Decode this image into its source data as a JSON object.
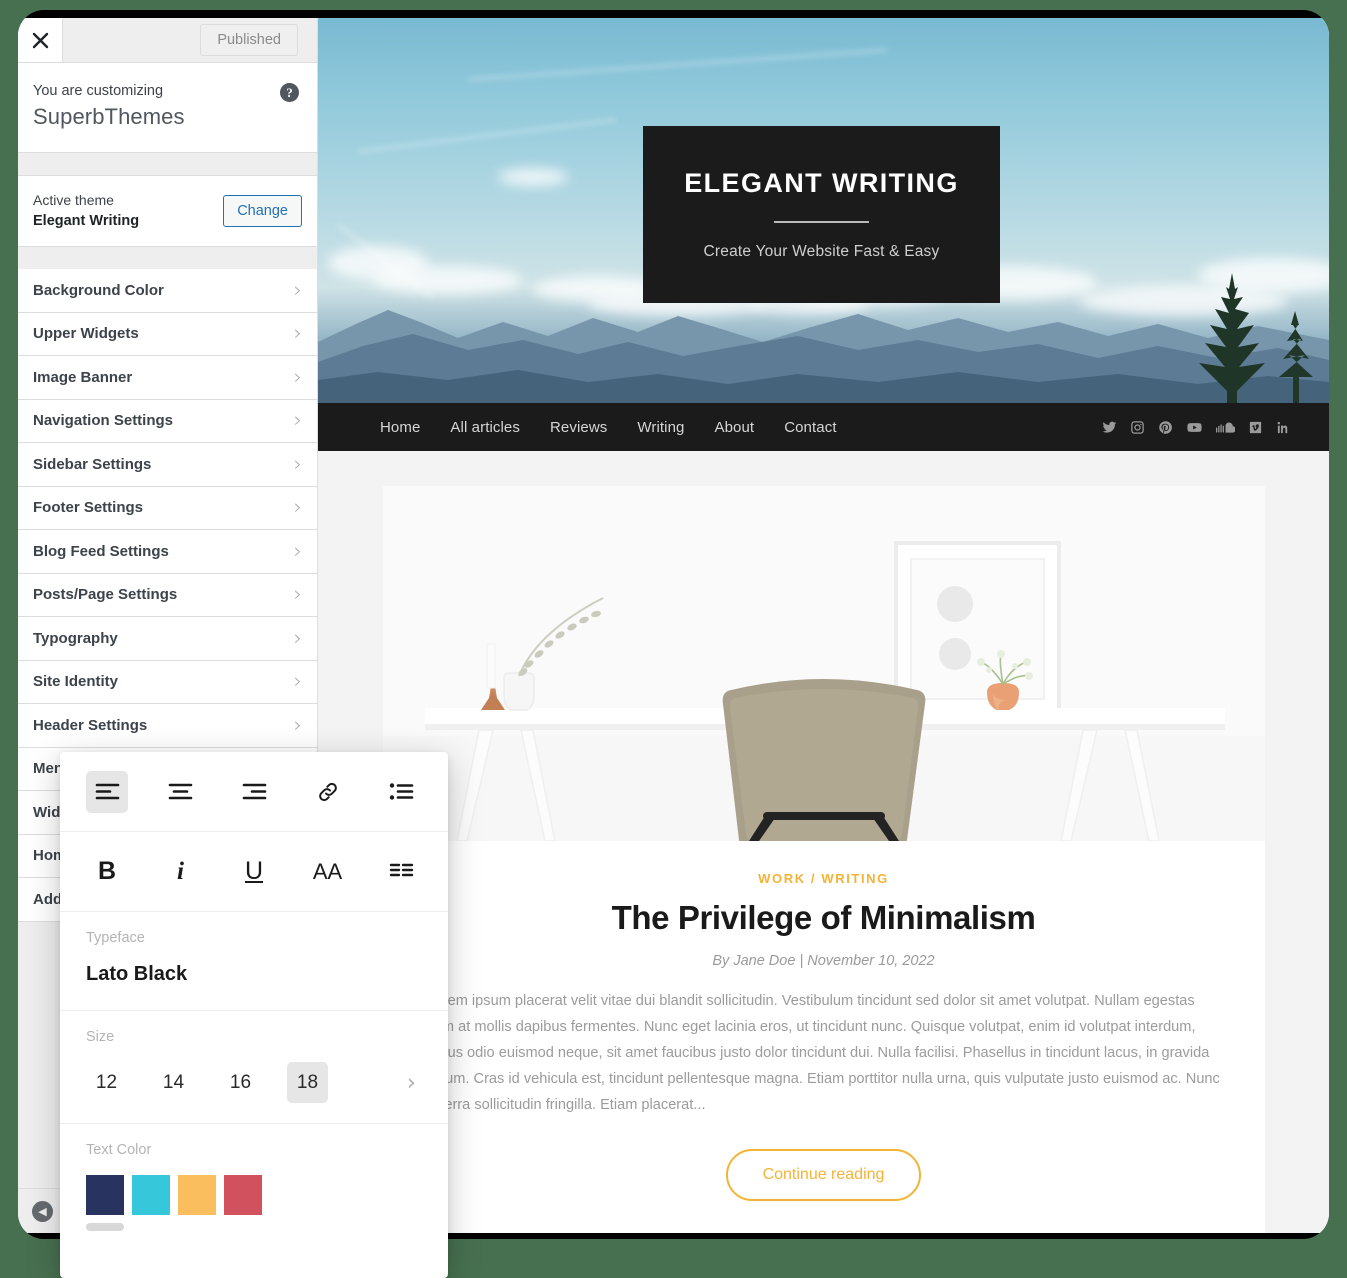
{
  "page": {
    "background_color": "#477050"
  },
  "customizer": {
    "close_icon": "close-icon",
    "published_label": "Published",
    "customizing_label": "You are customizing",
    "site_name": "SuperbThemes",
    "help_icon": "?",
    "active_theme_label": "Active theme",
    "active_theme_name": "Elegant Writing",
    "change_button": "Change",
    "sections": [
      {
        "label": "Background Color"
      },
      {
        "label": "Upper Widgets"
      },
      {
        "label": "Image Banner"
      },
      {
        "label": "Navigation Settings"
      },
      {
        "label": "Sidebar Settings"
      },
      {
        "label": "Footer Settings"
      },
      {
        "label": "Blog Feed Settings"
      },
      {
        "label": "Posts/Page Settings"
      },
      {
        "label": "Typography"
      },
      {
        "label": "Site Identity"
      },
      {
        "label": "Header Settings"
      },
      {
        "label": "Menus"
      },
      {
        "label": "Widgets"
      },
      {
        "label": "Homepage Settings"
      },
      {
        "label": "Additional CSS"
      }
    ],
    "chevron": "›",
    "collapse_label": "Hide Controls"
  },
  "preview": {
    "hero": {
      "title": "ELEGANT WRITING",
      "subtitle": "Create Your Website Fast & Easy"
    },
    "nav": {
      "items": [
        {
          "label": "Home"
        },
        {
          "label": "All articles"
        },
        {
          "label": "Reviews"
        },
        {
          "label": "Writing"
        },
        {
          "label": "About"
        },
        {
          "label": "Contact"
        }
      ],
      "social": [
        {
          "name": "twitter-icon"
        },
        {
          "name": "instagram-icon"
        },
        {
          "name": "pinterest-icon"
        },
        {
          "name": "youtube-icon"
        },
        {
          "name": "soundcloud-icon"
        },
        {
          "name": "vimeo-icon"
        },
        {
          "name": "linkedin-icon"
        }
      ]
    },
    "post": {
      "category": "WORK / WRITING",
      "title": "The Privilege of Minimalism",
      "meta": "By Jane Doe | November 10, 2022",
      "excerpt": "Lorem ipsum placerat velit vitae dui blandit sollicitudin. Vestibulum tincidunt sed dolor sit amet volutpat. Nullam egestas sem at mollis dapibus fermentes. Nunc eget lacinia eros, ut tincidunt nunc. Quisque volutpat, enim id volutpat interdum, purus odio euismod neque, sit amet faucibus justo dolor tincidunt dui. Nulla facilisi. Phasellus in tincidunt lacus, in gravida ipsum. Cras id vehicula est, tincidunt pellentesque magna. Etiam porttitor nulla urna, quis vulputate justo euismod ac. Nunc viverra sollicitudin fringilla. Etiam placerat...",
      "continue_label": "Continue reading",
      "accent_color": "#f5b335"
    }
  },
  "typography_panel": {
    "align_tools": [
      {
        "name": "align-left-icon",
        "active": true
      },
      {
        "name": "align-center-icon",
        "active": false
      },
      {
        "name": "align-right-icon",
        "active": false
      },
      {
        "name": "link-icon",
        "active": false
      },
      {
        "name": "bullet-list-icon",
        "active": false
      }
    ],
    "format_tools": [
      {
        "name": "bold-icon",
        "glyph": "B"
      },
      {
        "name": "italic-icon",
        "glyph": "i"
      },
      {
        "name": "underline-icon",
        "glyph": "U"
      },
      {
        "name": "text-size-icon",
        "glyph": "AA"
      },
      {
        "name": "line-height-icon",
        "glyph": "≡"
      }
    ],
    "typeface_label": "Typeface",
    "typeface_value": "Lato Black",
    "size_label": "Size",
    "sizes": [
      {
        "value": "12",
        "active": false
      },
      {
        "value": "14",
        "active": false
      },
      {
        "value": "16",
        "active": false
      },
      {
        "value": "18",
        "active": true
      }
    ],
    "size_next": "›",
    "text_color_label": "Text Color",
    "colors": [
      {
        "hex": "#293360",
        "selected": true
      },
      {
        "hex": "#36c7da",
        "selected": false
      },
      {
        "hex": "#fbbe5e",
        "selected": false
      },
      {
        "hex": "#d2515e",
        "selected": false
      }
    ]
  }
}
